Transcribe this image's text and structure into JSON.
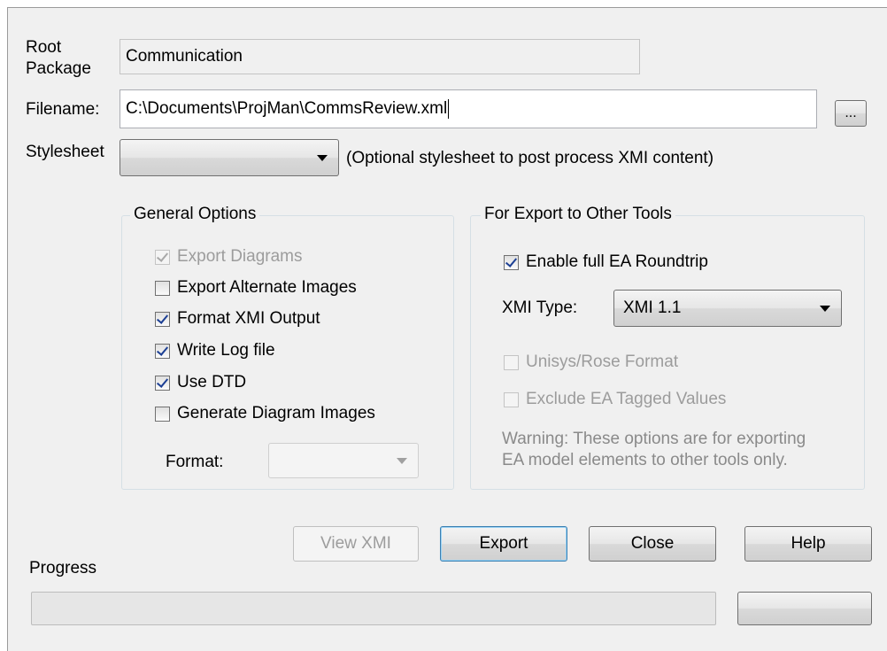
{
  "root_package": {
    "label_line1": "Root",
    "label_line2": "Package",
    "value": "Communication"
  },
  "filename": {
    "label": "Filename:",
    "value": "C:\\Documents\\ProjMan\\CommsReview.xml",
    "browse_label": "..."
  },
  "stylesheet": {
    "label": "Stylesheet",
    "value": "",
    "hint": "(Optional stylesheet to post process XMI content)"
  },
  "general_options": {
    "title": "General Options",
    "export_diagrams": {
      "label": "Export Diagrams",
      "checked": true,
      "enabled": false
    },
    "export_alternate_images": {
      "label": "Export Alternate Images",
      "checked": false,
      "enabled": true
    },
    "format_xmi_output": {
      "label": "Format XMI Output",
      "checked": true,
      "enabled": true
    },
    "write_log_file": {
      "label": "Write Log file",
      "checked": true,
      "enabled": true
    },
    "use_dtd": {
      "label": "Use DTD",
      "checked": true,
      "enabled": true
    },
    "generate_diagram_images": {
      "label": "Generate Diagram Images",
      "checked": false,
      "enabled": true
    },
    "format": {
      "label": "Format:",
      "value": "",
      "enabled": false
    }
  },
  "export_other_tools": {
    "title": "For Export to Other Tools",
    "enable_roundtrip": {
      "label": "Enable full EA Roundtrip",
      "checked": true,
      "enabled": true
    },
    "xmi_type": {
      "label": "XMI Type:",
      "value": "XMI 1.1"
    },
    "unisys_rose_format": {
      "label": "Unisys/Rose Format",
      "checked": false,
      "enabled": false
    },
    "exclude_tagged_values": {
      "label": "Exclude EA Tagged Values",
      "checked": false,
      "enabled": false
    },
    "warning_line1": "Warning: These options are for exporting",
    "warning_line2": "EA model elements to other tools only."
  },
  "buttons": {
    "view_xmi": "View XMI",
    "export": "Export",
    "close": "Close",
    "help": "Help"
  },
  "progress": {
    "label": "Progress",
    "value": 0
  },
  "colors": {
    "dialog_bg": "#f0f0f0",
    "check_mark": "#1c3f94",
    "disabled_text": "#9c9c9c",
    "default_button_border": "#3c7fb1"
  }
}
